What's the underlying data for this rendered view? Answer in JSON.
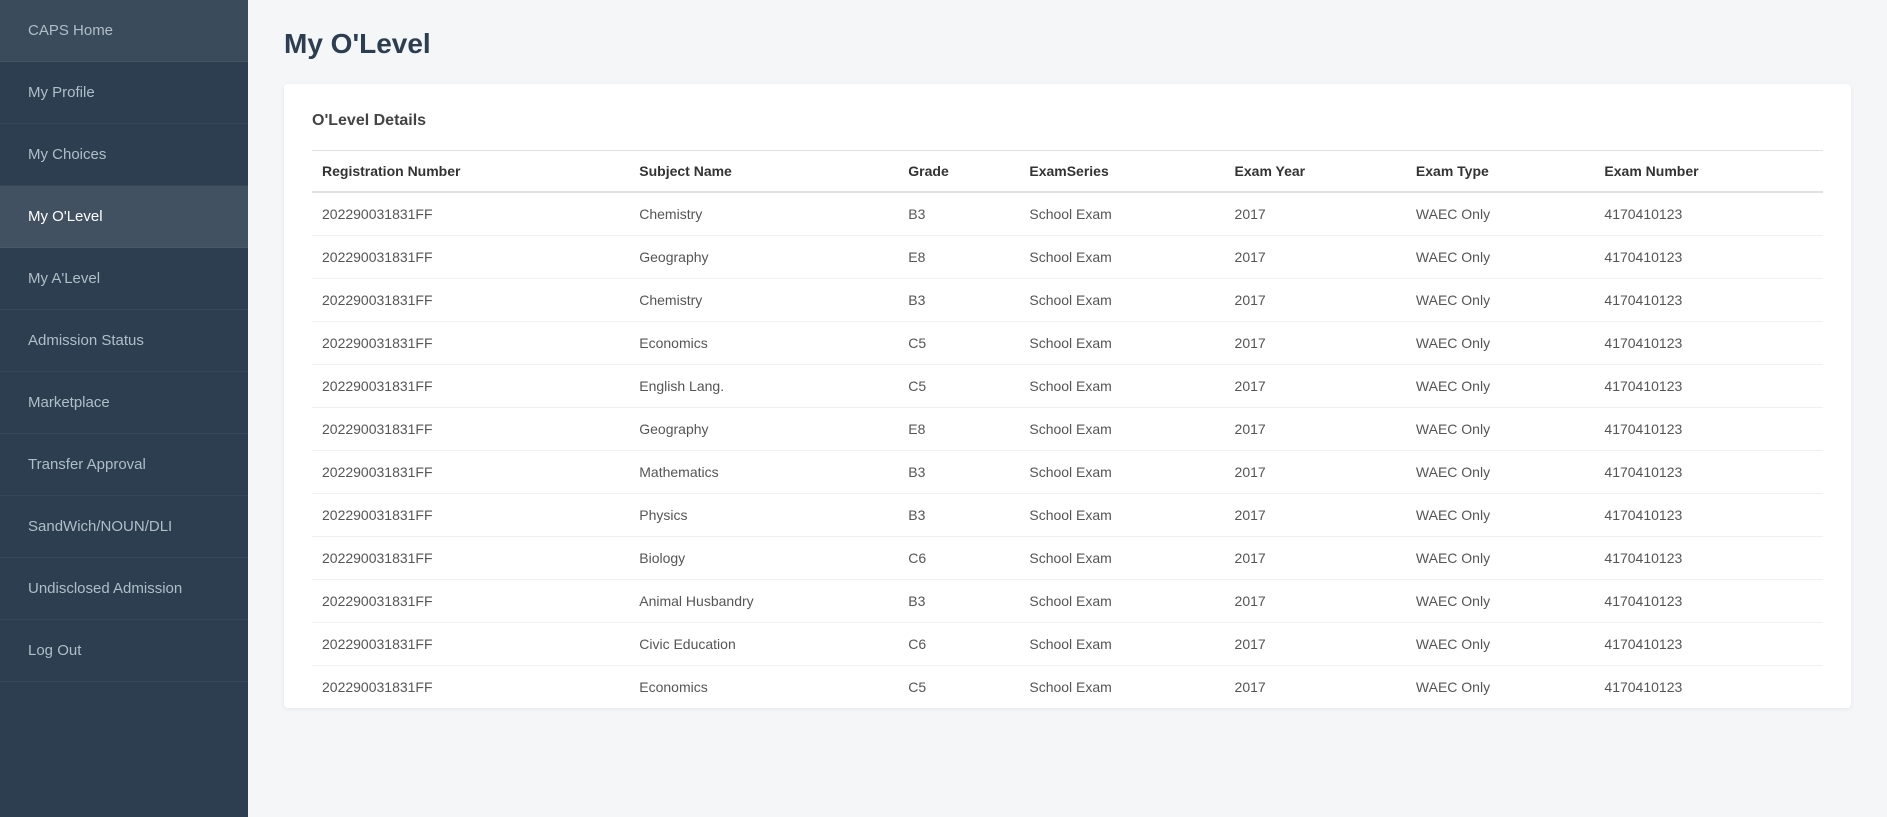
{
  "sidebar": {
    "items": [
      {
        "id": "caps-home",
        "label": "CAPS Home",
        "active": false
      },
      {
        "id": "my-profile",
        "label": "My Profile",
        "active": false
      },
      {
        "id": "my-choices",
        "label": "My Choices",
        "active": false
      },
      {
        "id": "my-olevel",
        "label": "My O'Level",
        "active": true
      },
      {
        "id": "my-alevel",
        "label": "My A'Level",
        "active": false
      },
      {
        "id": "admission-status",
        "label": "Admission Status",
        "active": false
      },
      {
        "id": "marketplace",
        "label": "Marketplace",
        "active": false
      },
      {
        "id": "transfer-approval",
        "label": "Transfer Approval",
        "active": false
      },
      {
        "id": "sandwich-noun-dli",
        "label": "SandWich/NOUN/DLI",
        "active": false
      },
      {
        "id": "undisclosed-admission",
        "label": "Undisclosed Admission",
        "active": false
      },
      {
        "id": "log-out",
        "label": "Log Out",
        "active": false
      }
    ]
  },
  "page": {
    "title": "My O'Level",
    "card_header": "O'Level Details"
  },
  "table": {
    "columns": [
      "Registration Number",
      "Subject Name",
      "Grade",
      "ExamSeries",
      "Exam Year",
      "Exam Type",
      "Exam Number"
    ],
    "rows": [
      {
        "reg": "202290031831FF",
        "subject": "Chemistry",
        "grade": "B3",
        "series": "School Exam",
        "year": "2017",
        "type": "WAEC Only",
        "number": "4170410123"
      },
      {
        "reg": "202290031831FF",
        "subject": "Geography",
        "grade": "E8",
        "series": "School Exam",
        "year": "2017",
        "type": "WAEC Only",
        "number": "4170410123"
      },
      {
        "reg": "202290031831FF",
        "subject": "Chemistry",
        "grade": "B3",
        "series": "School Exam",
        "year": "2017",
        "type": "WAEC Only",
        "number": "4170410123"
      },
      {
        "reg": "202290031831FF",
        "subject": "Economics",
        "grade": "C5",
        "series": "School Exam",
        "year": "2017",
        "type": "WAEC Only",
        "number": "4170410123"
      },
      {
        "reg": "202290031831FF",
        "subject": "English Lang.",
        "grade": "C5",
        "series": "School Exam",
        "year": "2017",
        "type": "WAEC Only",
        "number": "4170410123"
      },
      {
        "reg": "202290031831FF",
        "subject": "Geography",
        "grade": "E8",
        "series": "School Exam",
        "year": "2017",
        "type": "WAEC Only",
        "number": "4170410123"
      },
      {
        "reg": "202290031831FF",
        "subject": "Mathematics",
        "grade": "B3",
        "series": "School Exam",
        "year": "2017",
        "type": "WAEC Only",
        "number": "4170410123"
      },
      {
        "reg": "202290031831FF",
        "subject": "Physics",
        "grade": "B3",
        "series": "School Exam",
        "year": "2017",
        "type": "WAEC Only",
        "number": "4170410123"
      },
      {
        "reg": "202290031831FF",
        "subject": "Biology",
        "grade": "C6",
        "series": "School Exam",
        "year": "2017",
        "type": "WAEC Only",
        "number": "4170410123"
      },
      {
        "reg": "202290031831FF",
        "subject": "Animal Husbandry",
        "grade": "B3",
        "series": "School Exam",
        "year": "2017",
        "type": "WAEC Only",
        "number": "4170410123"
      },
      {
        "reg": "202290031831FF",
        "subject": "Civic Education",
        "grade": "C6",
        "series": "School Exam",
        "year": "2017",
        "type": "WAEC Only",
        "number": "4170410123"
      },
      {
        "reg": "202290031831FF",
        "subject": "Economics",
        "grade": "C5",
        "series": "School Exam",
        "year": "2017",
        "type": "WAEC Only",
        "number": "4170410123"
      }
    ]
  }
}
